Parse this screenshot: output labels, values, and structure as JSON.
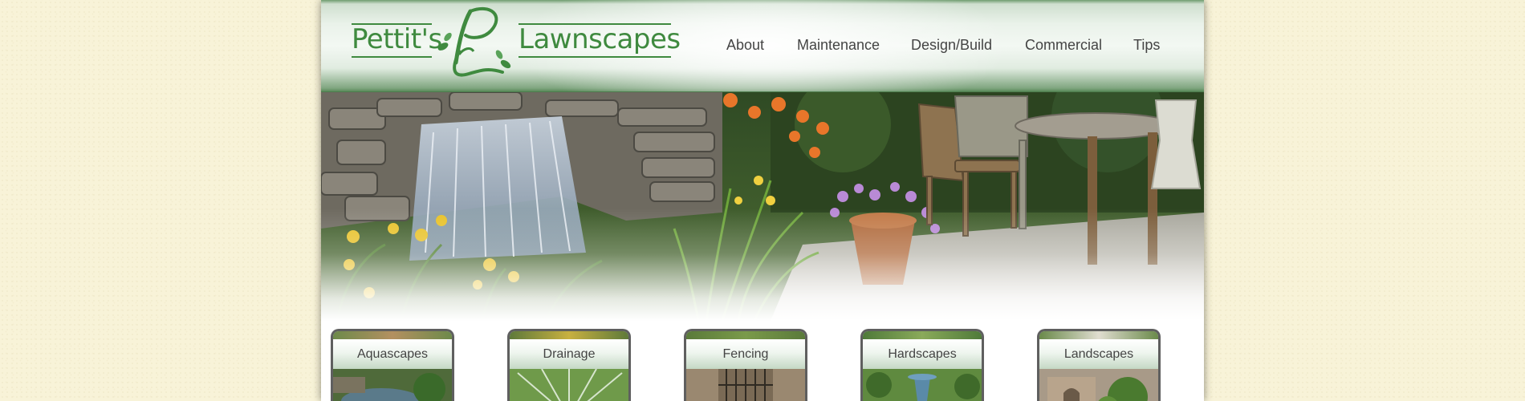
{
  "site": {
    "logo_left": "Pettit's",
    "logo_right": "Lawnscapes"
  },
  "nav": {
    "items": [
      {
        "label": "About"
      },
      {
        "label": "Maintenance"
      },
      {
        "label": "Design/Build"
      },
      {
        "label": "Commercial"
      },
      {
        "label": "Tips"
      }
    ]
  },
  "tiles": [
    {
      "label": "Aquascapes"
    },
    {
      "label": "Drainage"
    },
    {
      "label": "Fencing"
    },
    {
      "label": "Hardscapes"
    },
    {
      "label": "Landscapes"
    }
  ],
  "colors": {
    "page_bg": "#f8f3d8",
    "brand_green": "#3f8a3f",
    "nav_text": "#444444",
    "tile_border": "#5f5f5f"
  }
}
